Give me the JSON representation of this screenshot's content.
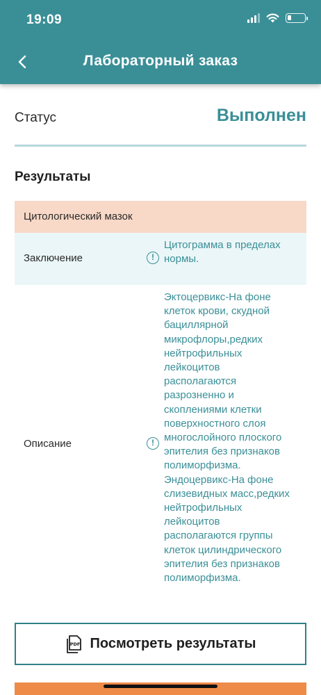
{
  "status_bar": {
    "time": "19:09"
  },
  "header": {
    "title": "Лабораторный заказ",
    "back_icon": "chevron-left-icon",
    "background_color": "#3a8f97"
  },
  "status": {
    "label": "Статус",
    "value": "Выполнен",
    "value_color": "#3a8f97"
  },
  "results": {
    "title": "Результаты",
    "section_title": "Цитологический мазок",
    "rows": [
      {
        "label": "Заключение",
        "icon": "info-icon",
        "value": "Цитограмма в пределах\nнормы."
      },
      {
        "label": "Описание",
        "icon": "info-icon",
        "value": " Эктоцервикс-На фоне\nклеток крови, скудной\nбациллярной\nмикрофлоры,редких\nнейтрофильных\nлейкоцитов\nрасполагаются\nразрозненно и\nскоплениями клетки\nповерхностного слоя\nмногослойного плоского\nэпителия без признаков\nполиморфизма.\nЭндоцервикс-На фоне\nслизевидных масс,редких\nнейтрофильных\nлейкоцитов\nрасполагаются группы\nклеток цилиндрического\nэпителия без признаков\nполиморфизма."
      }
    ]
  },
  "actions": {
    "view_results_label": "Посмотреть результаты",
    "view_results_icon": "pdf-icon",
    "bottom_bar_color": "#ef8b48"
  }
}
